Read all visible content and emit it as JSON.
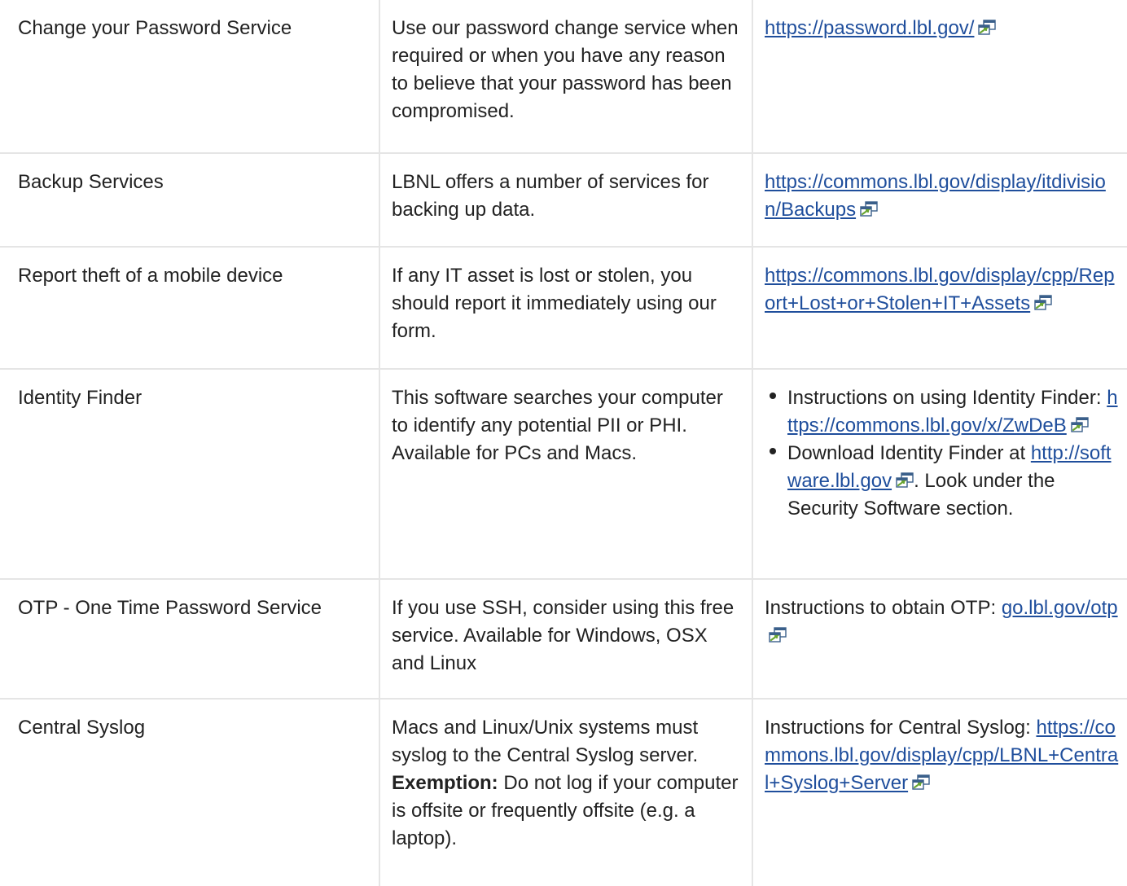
{
  "rows": [
    {
      "service": "Change your Password Service",
      "description": "Use our password change service when required or when you have any reason to believe that your password has been compromised.",
      "link": "https://password.lbl.gov/"
    },
    {
      "service": "Backup Services",
      "description": "LBNL offers a number of services for backing up data.",
      "link": "https://commons.lbl.gov/display/itdivision/Backups"
    },
    {
      "service": "Report theft of a mobile device",
      "description": "If any IT asset is lost or stolen, you should report it immediately using our form.",
      "link": "https://commons.lbl.gov/display/cpp/Report+Lost+or+Stolen+IT+Assets"
    },
    {
      "service": "Identity Finder",
      "description": "This software searches your computer to identify any potential PII or PHI. Available for PCs and Macs.",
      "items": [
        {
          "text": "Instructions on using Identity Finder: ",
          "link": "https://commons.lbl.gov/x/ZwDeB",
          "after": ""
        },
        {
          "text": "Download Identity Finder at ",
          "link": "http://software.lbl.gov",
          "after": ". Look under the Security Software section."
        }
      ]
    },
    {
      "service": "OTP - One Time Password Service",
      "description": "If you use SSH, consider using this free service. Available for Windows, OSX and Linux",
      "prefix": "Instructions to obtain OTP: ",
      "link": "go.lbl.gov/otp"
    },
    {
      "service": "Central Syslog",
      "description": "Macs and Linux/Unix systems must syslog to the Central Syslog server.",
      "exemption_label": "Exemption:",
      "exemption_text": " Do not log if your computer is offsite or frequently offsite (e.g. a laptop).",
      "prefix": "Instructions for Central Syslog: ",
      "link": "https://commons.lbl.gov/display/cpp/LBNL+Central+Syslog+Server"
    }
  ],
  "icon": "external-link-icon",
  "colors": {
    "link": "#1f4e9c",
    "border": "#e5e5e5",
    "text": "#222222",
    "icon_green": "#6aa632"
  }
}
